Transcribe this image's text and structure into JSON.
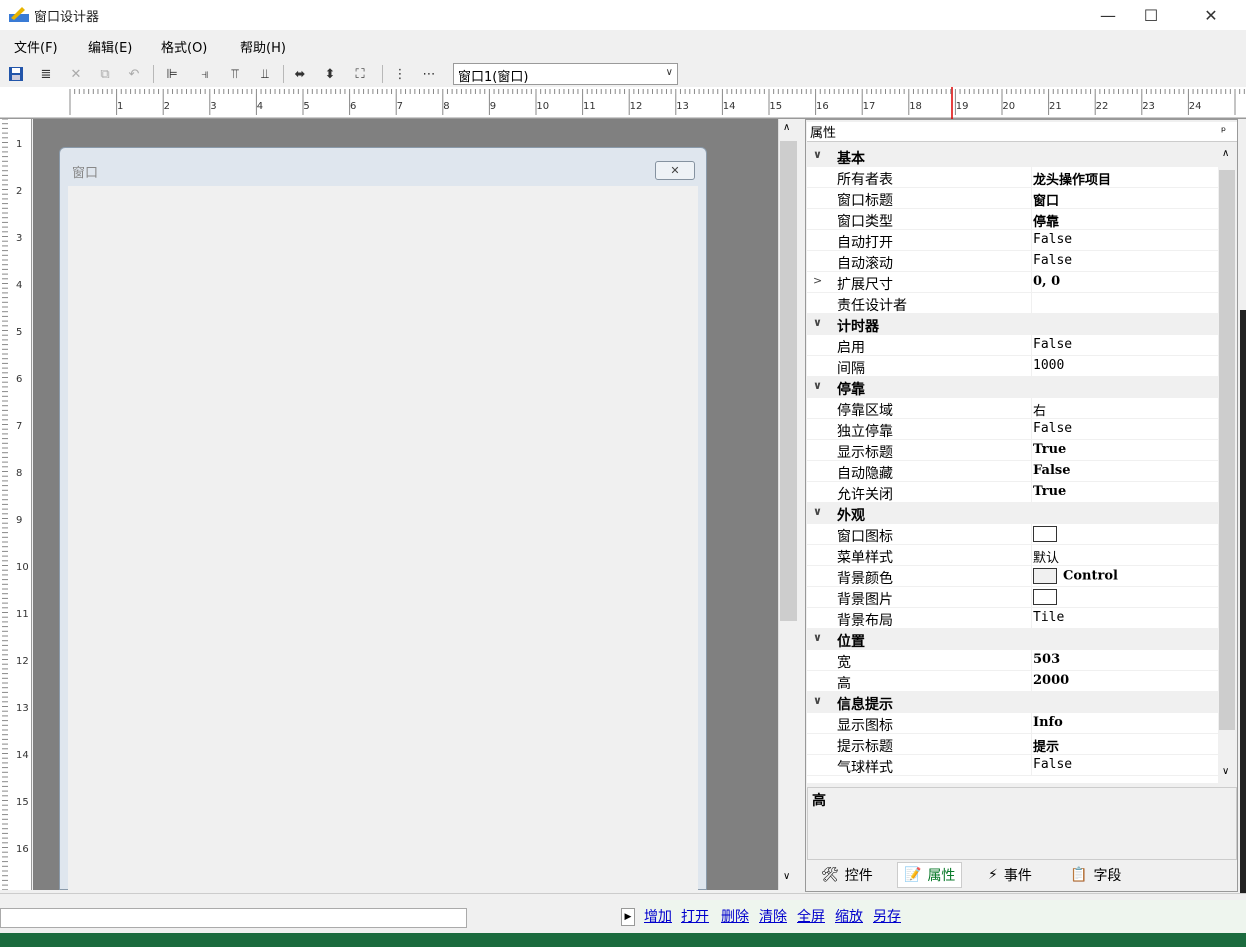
{
  "window": {
    "title": "窗口设计器",
    "minimize": "—",
    "maximize": "☐",
    "close": "✕"
  },
  "menu": [
    "文件(F)",
    "编辑(E)",
    "格式(O)",
    "帮助(H)"
  ],
  "toolbar": {
    "combo_value": "窗口1(窗口)"
  },
  "ruler": {
    "h": [
      "1",
      "2",
      "3",
      "4",
      "5",
      "6",
      "7",
      "8",
      "9",
      "10",
      "11",
      "12",
      "13",
      "14",
      "15",
      "16",
      "17",
      "18",
      "19",
      "20",
      "21",
      "22",
      "23",
      "24"
    ],
    "v": [
      "1",
      "2",
      "3",
      "4",
      "5",
      "6",
      "7",
      "8",
      "9",
      "10",
      "11",
      "12",
      "13",
      "14",
      "15",
      "16"
    ]
  },
  "design": {
    "window_title": "窗口",
    "close_glyph": "✕"
  },
  "panel": {
    "title": "属性",
    "pin": "ᵖ"
  },
  "properties": [
    {
      "type": "cat",
      "label": "基本",
      "chev": "∨"
    },
    {
      "type": "prop",
      "label": "所有者表",
      "value": "龙头操作项目",
      "bold": true
    },
    {
      "type": "prop",
      "label": "窗口标题",
      "value": "窗口",
      "bold": true
    },
    {
      "type": "prop",
      "label": "窗口类型",
      "value": "停靠",
      "bold": true
    },
    {
      "type": "prop",
      "label": "自动打开",
      "value": "False"
    },
    {
      "type": "prop",
      "label": "自动滚动",
      "value": "False"
    },
    {
      "type": "prop",
      "label": "扩展尺寸",
      "value": "0, 0",
      "bold": true,
      "chev": ">"
    },
    {
      "type": "prop",
      "label": "责任设计者",
      "value": ""
    },
    {
      "type": "cat",
      "label": "计时器",
      "chev": "∨"
    },
    {
      "type": "prop",
      "label": "启用",
      "value": "False"
    },
    {
      "type": "prop",
      "label": "间隔",
      "value": "1000"
    },
    {
      "type": "cat",
      "label": "停靠",
      "chev": "∨"
    },
    {
      "type": "prop",
      "label": "停靠区域",
      "value": "右"
    },
    {
      "type": "prop",
      "label": "独立停靠",
      "value": "False"
    },
    {
      "type": "prop",
      "label": "显示标题",
      "value": "True",
      "bold": true
    },
    {
      "type": "prop",
      "label": "自动隐藏",
      "value": "False",
      "bold": true
    },
    {
      "type": "prop",
      "label": "允许关闭",
      "value": "True",
      "bold": true
    },
    {
      "type": "cat",
      "label": "外观",
      "chev": "∨"
    },
    {
      "type": "prop",
      "label": "窗口图标",
      "value": "",
      "swatch": "white"
    },
    {
      "type": "prop",
      "label": "菜单样式",
      "value": "默认"
    },
    {
      "type": "prop",
      "label": "背景颜色",
      "value": "Control",
      "bold": true,
      "swatch": "gray"
    },
    {
      "type": "prop",
      "label": "背景图片",
      "value": "",
      "swatch": "white"
    },
    {
      "type": "prop",
      "label": "背景布局",
      "value": "Tile"
    },
    {
      "type": "cat",
      "label": "位置",
      "chev": "∨"
    },
    {
      "type": "prop",
      "label": "宽",
      "value": "503",
      "bold": true
    },
    {
      "type": "prop",
      "label": "高",
      "value": "2000",
      "bold": true
    },
    {
      "type": "cat",
      "label": "信息提示",
      "chev": "∨"
    },
    {
      "type": "prop",
      "label": "显示图标",
      "value": "Info",
      "bold": true
    },
    {
      "type": "prop",
      "label": "提示标题",
      "value": "提示",
      "bold": true
    },
    {
      "type": "prop",
      "label": "气球样式",
      "value": "False"
    }
  ],
  "description": {
    "title": "高"
  },
  "tabs": [
    {
      "label": "控件",
      "icon": "🛠"
    },
    {
      "label": "属性",
      "icon": "📝"
    },
    {
      "label": "事件",
      "icon": "⚡"
    },
    {
      "label": "字段",
      "icon": "📋"
    }
  ],
  "links": [
    "增加",
    "打开",
    "删除",
    "清除",
    "全屏",
    "缩放",
    "另存"
  ],
  "colors": {
    "accent_green": "#0a7a2a",
    "link": "#0000cc",
    "status_green": "#1b6b3e"
  }
}
